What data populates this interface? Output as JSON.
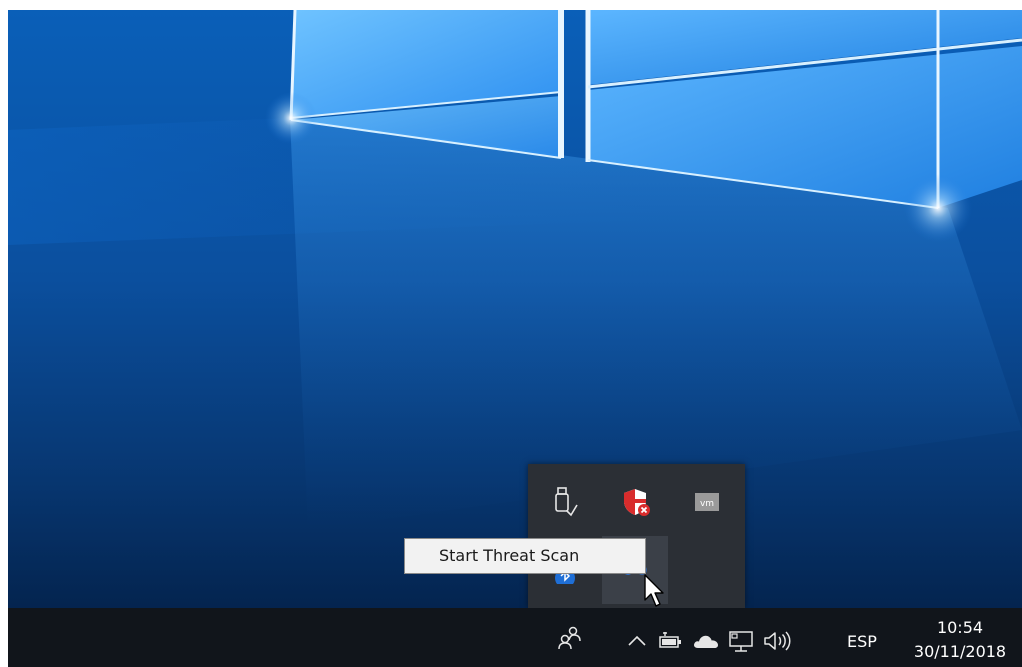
{
  "desktop": {
    "wallpaper": "windows-10-hero",
    "accent": "#0b5cb5"
  },
  "overflow_tray": {
    "icons": [
      {
        "name": "usb-safely-remove-icon"
      },
      {
        "name": "security-shield-alert-icon"
      },
      {
        "name": "vmware-icon"
      },
      {
        "name": "bluetooth-icon"
      },
      {
        "name": "threat-scan-icon"
      }
    ]
  },
  "tooltip": {
    "text": "Start Threat Scan"
  },
  "taskbar": {
    "people_icon": "people-icon",
    "show_hidden_icon": "chevron-up-icon",
    "tray_icons": [
      "battery-icon",
      "onedrive-cloud-icon",
      "network-icon",
      "volume-icon"
    ],
    "language": "ESP",
    "clock": {
      "time": "10:54",
      "date": "30/11/2018"
    }
  }
}
